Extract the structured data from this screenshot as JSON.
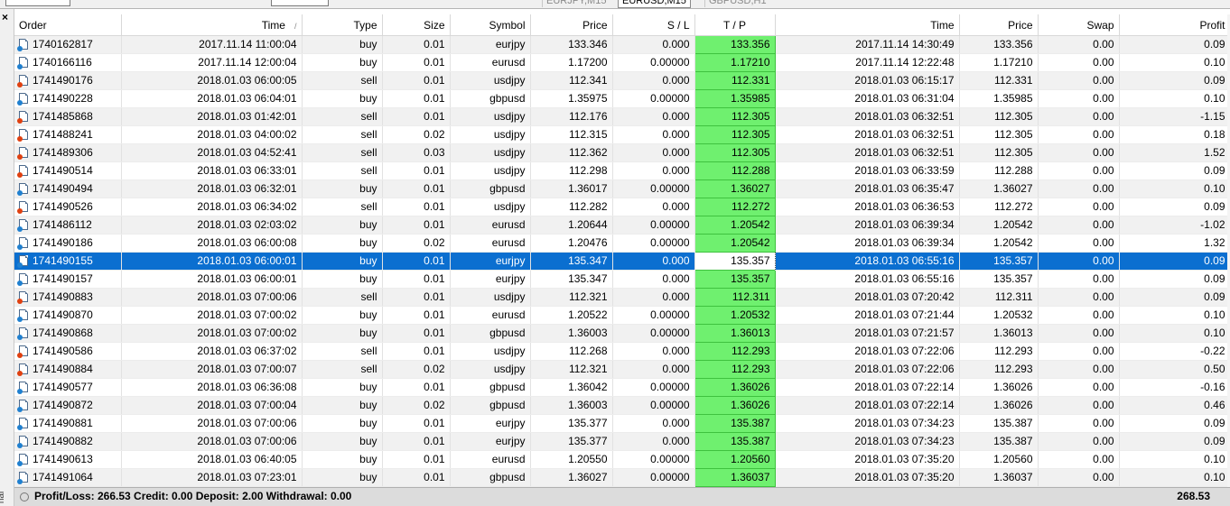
{
  "chart_tabs": [
    {
      "label": "EURJPY,M15",
      "active": false
    },
    {
      "label": "EURUSD,M15",
      "active": true
    },
    {
      "label": "GBPUSD,H1",
      "active": false
    }
  ],
  "panel": {
    "close_glyph": "×",
    "side_label": "nal"
  },
  "columns": [
    "Order",
    "Time",
    "Type",
    "Size",
    "Symbol",
    "Price",
    "S / L",
    "T / P",
    "Time",
    "Price",
    "Swap",
    "Profit"
  ],
  "selected_order": "1741490155",
  "rows": [
    [
      "1740162817",
      "2017.11.14 11:00:04",
      "buy",
      "0.01",
      "eurjpy",
      "133.346",
      "0.000",
      "133.356",
      "2017.11.14 14:30:49",
      "133.356",
      "0.00",
      "0.09"
    ],
    [
      "1740166116",
      "2017.11.14 12:00:04",
      "buy",
      "0.01",
      "eurusd",
      "1.17200",
      "0.00000",
      "1.17210",
      "2017.11.14 12:22:48",
      "1.17210",
      "0.00",
      "0.10"
    ],
    [
      "1741490176",
      "2018.01.03 06:00:05",
      "sell",
      "0.01",
      "usdjpy",
      "112.341",
      "0.000",
      "112.331",
      "2018.01.03 06:15:17",
      "112.331",
      "0.00",
      "0.09"
    ],
    [
      "1741490228",
      "2018.01.03 06:04:01",
      "buy",
      "0.01",
      "gbpusd",
      "1.35975",
      "0.00000",
      "1.35985",
      "2018.01.03 06:31:04",
      "1.35985",
      "0.00",
      "0.10"
    ],
    [
      "1741485868",
      "2018.01.03 01:42:01",
      "sell",
      "0.01",
      "usdjpy",
      "112.176",
      "0.000",
      "112.305",
      "2018.01.03 06:32:51",
      "112.305",
      "0.00",
      "-1.15"
    ],
    [
      "1741488241",
      "2018.01.03 04:00:02",
      "sell",
      "0.02",
      "usdjpy",
      "112.315",
      "0.000",
      "112.305",
      "2018.01.03 06:32:51",
      "112.305",
      "0.00",
      "0.18"
    ],
    [
      "1741489306",
      "2018.01.03 04:52:41",
      "sell",
      "0.03",
      "usdjpy",
      "112.362",
      "0.000",
      "112.305",
      "2018.01.03 06:32:51",
      "112.305",
      "0.00",
      "1.52"
    ],
    [
      "1741490514",
      "2018.01.03 06:33:01",
      "sell",
      "0.01",
      "usdjpy",
      "112.298",
      "0.000",
      "112.288",
      "2018.01.03 06:33:59",
      "112.288",
      "0.00",
      "0.09"
    ],
    [
      "1741490494",
      "2018.01.03 06:32:01",
      "buy",
      "0.01",
      "gbpusd",
      "1.36017",
      "0.00000",
      "1.36027",
      "2018.01.03 06:35:47",
      "1.36027",
      "0.00",
      "0.10"
    ],
    [
      "1741490526",
      "2018.01.03 06:34:02",
      "sell",
      "0.01",
      "usdjpy",
      "112.282",
      "0.000",
      "112.272",
      "2018.01.03 06:36:53",
      "112.272",
      "0.00",
      "0.09"
    ],
    [
      "1741486112",
      "2018.01.03 02:03:02",
      "buy",
      "0.01",
      "eurusd",
      "1.20644",
      "0.00000",
      "1.20542",
      "2018.01.03 06:39:34",
      "1.20542",
      "0.00",
      "-1.02"
    ],
    [
      "1741490186",
      "2018.01.03 06:00:08",
      "buy",
      "0.02",
      "eurusd",
      "1.20476",
      "0.00000",
      "1.20542",
      "2018.01.03 06:39:34",
      "1.20542",
      "0.00",
      "1.32"
    ],
    [
      "1741490155",
      "2018.01.03 06:00:01",
      "buy",
      "0.01",
      "eurjpy",
      "135.347",
      "0.000",
      "135.357",
      "2018.01.03 06:55:16",
      "135.357",
      "0.00",
      "0.09"
    ],
    [
      "1741490157",
      "2018.01.03 06:00:01",
      "buy",
      "0.01",
      "eurjpy",
      "135.347",
      "0.000",
      "135.357",
      "2018.01.03 06:55:16",
      "135.357",
      "0.00",
      "0.09"
    ],
    [
      "1741490883",
      "2018.01.03 07:00:06",
      "sell",
      "0.01",
      "usdjpy",
      "112.321",
      "0.000",
      "112.311",
      "2018.01.03 07:20:42",
      "112.311",
      "0.00",
      "0.09"
    ],
    [
      "1741490870",
      "2018.01.03 07:00:02",
      "buy",
      "0.01",
      "eurusd",
      "1.20522",
      "0.00000",
      "1.20532",
      "2018.01.03 07:21:44",
      "1.20532",
      "0.00",
      "0.10"
    ],
    [
      "1741490868",
      "2018.01.03 07:00:02",
      "buy",
      "0.01",
      "gbpusd",
      "1.36003",
      "0.00000",
      "1.36013",
      "2018.01.03 07:21:57",
      "1.36013",
      "0.00",
      "0.10"
    ],
    [
      "1741490586",
      "2018.01.03 06:37:02",
      "sell",
      "0.01",
      "usdjpy",
      "112.268",
      "0.000",
      "112.293",
      "2018.01.03 07:22:06",
      "112.293",
      "0.00",
      "-0.22"
    ],
    [
      "1741490884",
      "2018.01.03 07:00:07",
      "sell",
      "0.02",
      "usdjpy",
      "112.321",
      "0.000",
      "112.293",
      "2018.01.03 07:22:06",
      "112.293",
      "0.00",
      "0.50"
    ],
    [
      "1741490577",
      "2018.01.03 06:36:08",
      "buy",
      "0.01",
      "gbpusd",
      "1.36042",
      "0.00000",
      "1.36026",
      "2018.01.03 07:22:14",
      "1.36026",
      "0.00",
      "-0.16"
    ],
    [
      "1741490872",
      "2018.01.03 07:00:04",
      "buy",
      "0.02",
      "gbpusd",
      "1.36003",
      "0.00000",
      "1.36026",
      "2018.01.03 07:22:14",
      "1.36026",
      "0.00",
      "0.46"
    ],
    [
      "1741490881",
      "2018.01.03 07:00:06",
      "buy",
      "0.01",
      "eurjpy",
      "135.377",
      "0.000",
      "135.387",
      "2018.01.03 07:34:23",
      "135.387",
      "0.00",
      "0.09"
    ],
    [
      "1741490882",
      "2018.01.03 07:00:06",
      "buy",
      "0.01",
      "eurjpy",
      "135.377",
      "0.000",
      "135.387",
      "2018.01.03 07:34:23",
      "135.387",
      "0.00",
      "0.09"
    ],
    [
      "1741490613",
      "2018.01.03 06:40:05",
      "buy",
      "0.01",
      "eurusd",
      "1.20550",
      "0.00000",
      "1.20560",
      "2018.01.03 07:35:20",
      "1.20560",
      "0.00",
      "0.10"
    ],
    [
      "1741491064",
      "2018.01.03 07:23:01",
      "buy",
      "0.01",
      "gbpusd",
      "1.36027",
      "0.00000",
      "1.36037",
      "2018.01.03 07:35:20",
      "1.36037",
      "0.00",
      "0.10"
    ]
  ],
  "summary": {
    "text": "Profit/Loss: 266.53  Credit: 0.00  Deposit: 2.00  Withdrawal: 0.00",
    "total": "268.53"
  },
  "colors": {
    "tp_highlight": "#6ff06f",
    "selection": "#0b6fd0"
  }
}
